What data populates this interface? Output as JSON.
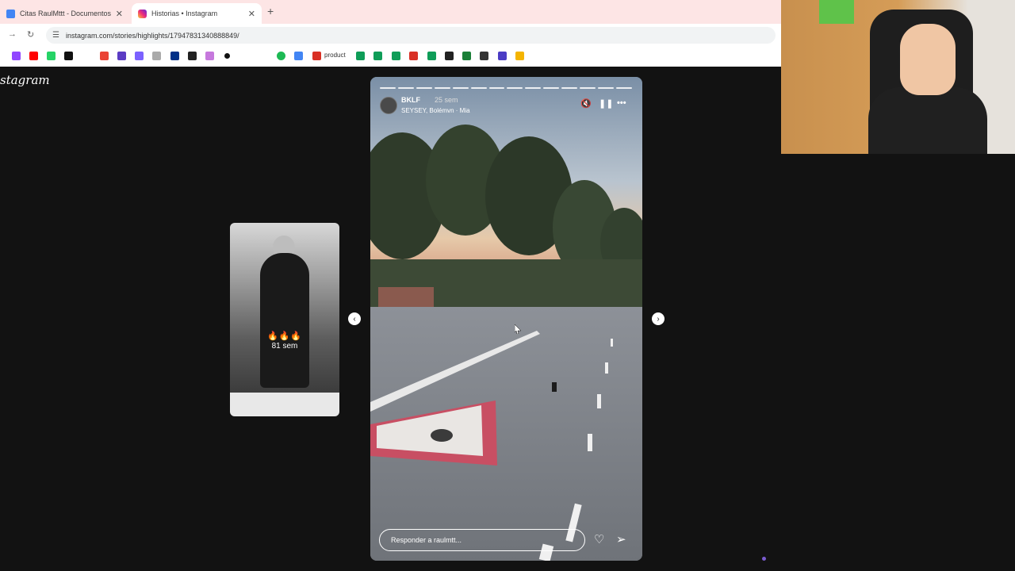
{
  "browser": {
    "tabs": [
      {
        "title": "Citas RaulMttt - Documentos d",
        "active": false
      },
      {
        "title": "Historias • Instagram",
        "active": true
      }
    ],
    "new_tab_glyph": "+",
    "close_glyph": "✕",
    "url": "instagram.com/stories/highlights/17947831340888849/",
    "bookmark_label": "product"
  },
  "instagram": {
    "logo": "stagram",
    "side_story": {
      "emoji": "🔥🔥🔥",
      "age": "81 sem"
    },
    "story": {
      "username": "BKLF",
      "time_ago": "25 sem",
      "music": "SEYSEY, Bolémvn · Mia",
      "progress_segments": 14,
      "reply_placeholder": "Responder a raulmtt..."
    }
  },
  "icons": {
    "prev": "chevron-left-icon",
    "next": "chevron-right-icon",
    "mute": "mute-icon",
    "pause": "pause-icon",
    "more": "more-icon",
    "like": "heart-icon",
    "share": "send-icon"
  }
}
